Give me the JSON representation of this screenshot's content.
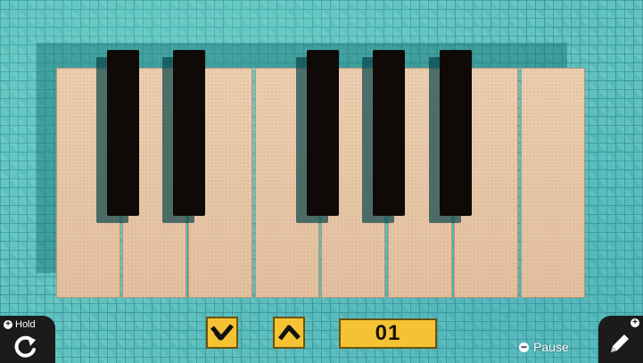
{
  "keyboard": {
    "white_keys": [
      "key-1",
      "key-2",
      "key-3",
      "key-4",
      "key-5",
      "key-6",
      "key-7",
      "key-8"
    ],
    "black_keys": [
      "black-1",
      "black-2",
      "black-3",
      "black-4",
      "black-5"
    ]
  },
  "controls": {
    "down_icon": "check-down-icon",
    "up_icon": "caret-up-icon",
    "counter_value": "01"
  },
  "hold": {
    "label": "Hold",
    "plus": "+",
    "icon": "rotate-icon"
  },
  "edit": {
    "plus": "+",
    "icon": "pencil-icon"
  },
  "pause": {
    "label": "Pause",
    "minus": "−"
  },
  "colors": {
    "background": "#5fc4c0",
    "white_key": "#e9c8a9",
    "black_key": "#0f0a08",
    "button": "#f5c233",
    "corner_panel": "#1b1b1b"
  }
}
